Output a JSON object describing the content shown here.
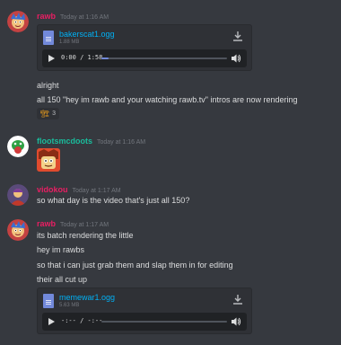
{
  "messages": [
    {
      "username": "rawb",
      "username_color": "#e91e63",
      "timestamp": "Today at 1:16 AM",
      "attachment": {
        "filename": "bakerscat1.ogg",
        "size": "1.88 MB",
        "time": "0:00 / 1:58",
        "progress": 0.06
      },
      "lines": [
        "alright",
        "all 150 \"hey im rawb and your watching rawb.tv\" intros are now rendering"
      ],
      "reaction": {
        "emoji": "crane",
        "count": "3"
      }
    },
    {
      "username": "flootsmcdoots",
      "username_color": "#1abc9c",
      "timestamp": "Today at 1:16 AM"
    },
    {
      "username": "vidokou",
      "username_color": "#e91e63",
      "timestamp": "Today at 1:17 AM",
      "lines": [
        "so what day is the video that's just all 150?"
      ]
    },
    {
      "username": "rawb",
      "username_color": "#e91e63",
      "timestamp": "Today at 1:17 AM",
      "lines": [
        "its batch rendering the little",
        "hey im rawbs",
        "so that i can just grab them and slap them in for editing",
        "their all cut up"
      ],
      "attachment": {
        "filename": "memewar1.ogg",
        "size": "5.63 MB",
        "time": "-:-- / -:--",
        "progress": 0
      }
    }
  ]
}
